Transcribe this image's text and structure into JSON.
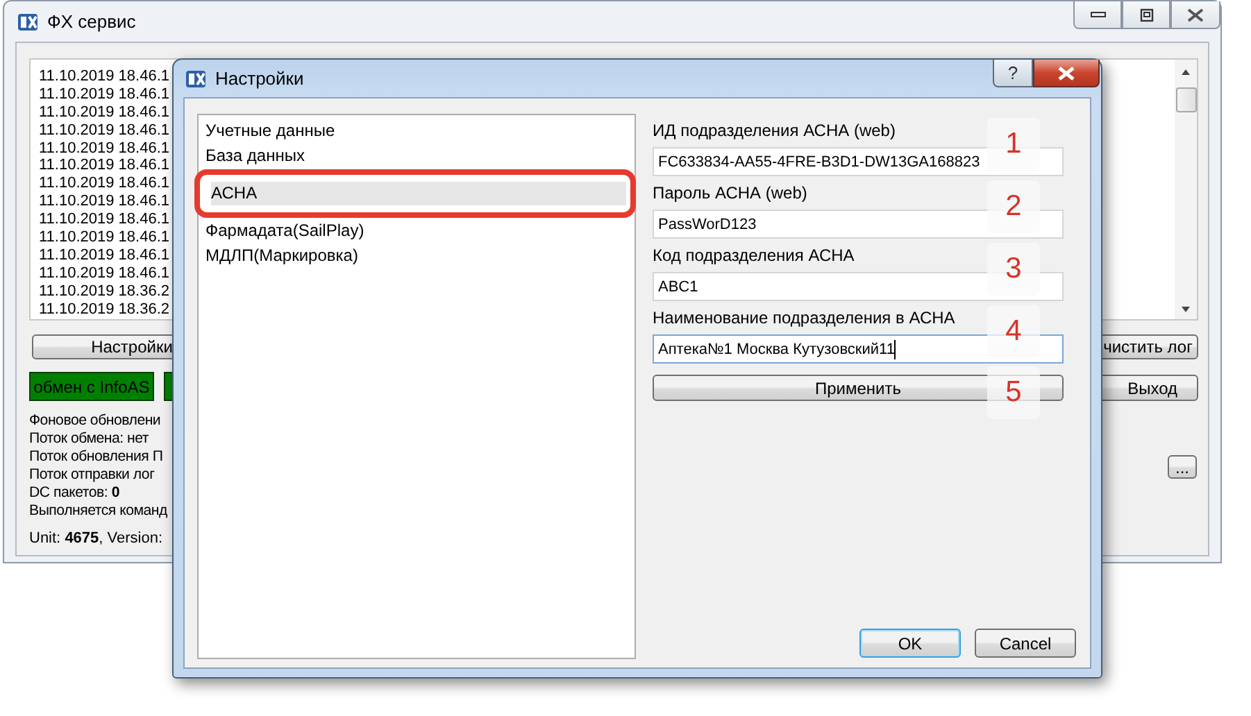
{
  "main_window": {
    "title": "ФХ сервис",
    "log_lines": [
      "11.10.2019 18.46.1",
      "11.10.2019 18.46.1",
      "11.10.2019 18.46.1",
      "11.10.2019 18.46.1",
      "11.10.2019 18.46.1",
      "11.10.2019 18.46.1",
      "11.10.2019 18.46.1",
      "11.10.2019 18.46.1",
      "11.10.2019 18.46.1",
      "11.10.2019 18.46.1",
      "11.10.2019 18.46.1",
      "11.10.2019 18.46.1",
      "11.10.2019 18.36.2",
      "11.10.2019 18.36.2"
    ],
    "settings_button": "Настройки",
    "exchange_button": "обмен с InfoAS",
    "status_lines": [
      "Фоновое обновлени",
      "Поток обмена: нет",
      "Поток обновления П",
      "Поток отправки лог",
      "DC пакетов: **0**",
      "Выполняется команд"
    ],
    "unit_line": "Unit: **4675**, Version:",
    "clear_log_button": "чистить лог",
    "exit_button": "Выход",
    "more_button": "..."
  },
  "dialog": {
    "title": "Настройки",
    "help_button": "?",
    "categories": [
      {
        "label": "Учетные данные",
        "selected": false
      },
      {
        "label": "База данных",
        "selected": false
      },
      {
        "label": "АСНА",
        "selected": true
      },
      {
        "label": "Фармадата(SailPlay)",
        "selected": false
      },
      {
        "label": "МДЛП(Маркировка)",
        "selected": false
      }
    ],
    "fields": [
      {
        "label": "ИД подразделения АСНА (web)",
        "value": "FC633834-AA55-4FRE-B3D1-DW13GA168823",
        "focused": false,
        "marker": "1"
      },
      {
        "label": "Пароль АСНА (web)",
        "value": "PassWorD123",
        "focused": false,
        "marker": "2"
      },
      {
        "label": "Код подразделения АСНА",
        "value": "ABC1",
        "focused": false,
        "marker": "3"
      },
      {
        "label": "Наименование подразделения в АСНА",
        "value": "Аптека№1 Москва Кутузовский11",
        "focused": true,
        "marker": "4"
      }
    ],
    "apply_button": "Применить",
    "apply_marker": "5",
    "ok_button": "OK",
    "cancel_button": "Cancel"
  }
}
